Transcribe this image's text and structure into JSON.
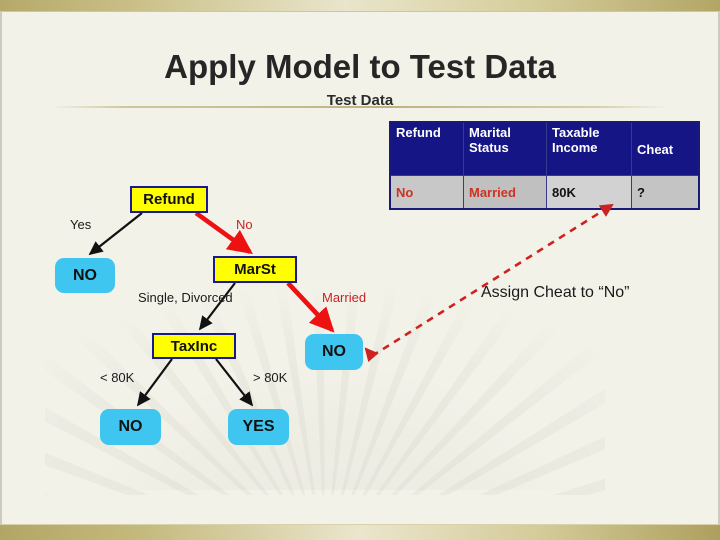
{
  "slide": {
    "title": "Apply Model to Test Data",
    "subtitle": "Test Data",
    "annotation": "Assign Cheat to “No”"
  },
  "test_data_table": {
    "headers": [
      "Refund",
      "Marital Status",
      "Taxable Income",
      "Cheat"
    ],
    "header_lines": [
      [
        "Refund"
      ],
      [
        "Marital",
        "Status"
      ],
      [
        "Taxable",
        "Income"
      ],
      [
        "Cheat"
      ]
    ],
    "rows": [
      {
        "refund": "No",
        "marital_status": "Married",
        "taxable_income": "80K",
        "cheat": "?"
      }
    ],
    "colors": {
      "header_bg": "#151585",
      "header_text": "#ffffff",
      "cell_bg": "#c8c8c8",
      "highlight_text": "#cc3322",
      "normal_text": "#111111"
    }
  },
  "decision_tree": {
    "nodes": [
      {
        "id": "refund",
        "label": "Refund",
        "type": "internal"
      },
      {
        "id": "marst",
        "label": "MarSt",
        "type": "internal"
      },
      {
        "id": "taxinc",
        "label": "TaxInc",
        "type": "internal"
      },
      {
        "id": "no_left",
        "label": "NO",
        "type": "leaf"
      },
      {
        "id": "no_right",
        "label": "NO",
        "type": "leaf"
      },
      {
        "id": "no_bottom",
        "label": "NO",
        "type": "leaf"
      },
      {
        "id": "yes_bottom",
        "label": "YES",
        "type": "leaf"
      }
    ],
    "edge_labels": {
      "yes": "Yes",
      "no": "No",
      "single_divorced": "Single, Divorced",
      "married": "Married",
      "lt_80k": "< 80K",
      "gt_80k": "> 80K"
    },
    "highlighted_path": [
      "refund",
      "marst",
      "no_right"
    ],
    "colors": {
      "internal_fill": "#ffff00",
      "internal_border": "#1a1a8c",
      "leaf_fill": "#3fc6f0",
      "edge": "#111111",
      "highlight_edge": "#ee1111",
      "label_text": "#1a1a1a",
      "highlight_label_text": "#cc2222"
    }
  },
  "theme": {
    "background": "#f3f2e9",
    "accent_bar": "#b5a96a"
  }
}
